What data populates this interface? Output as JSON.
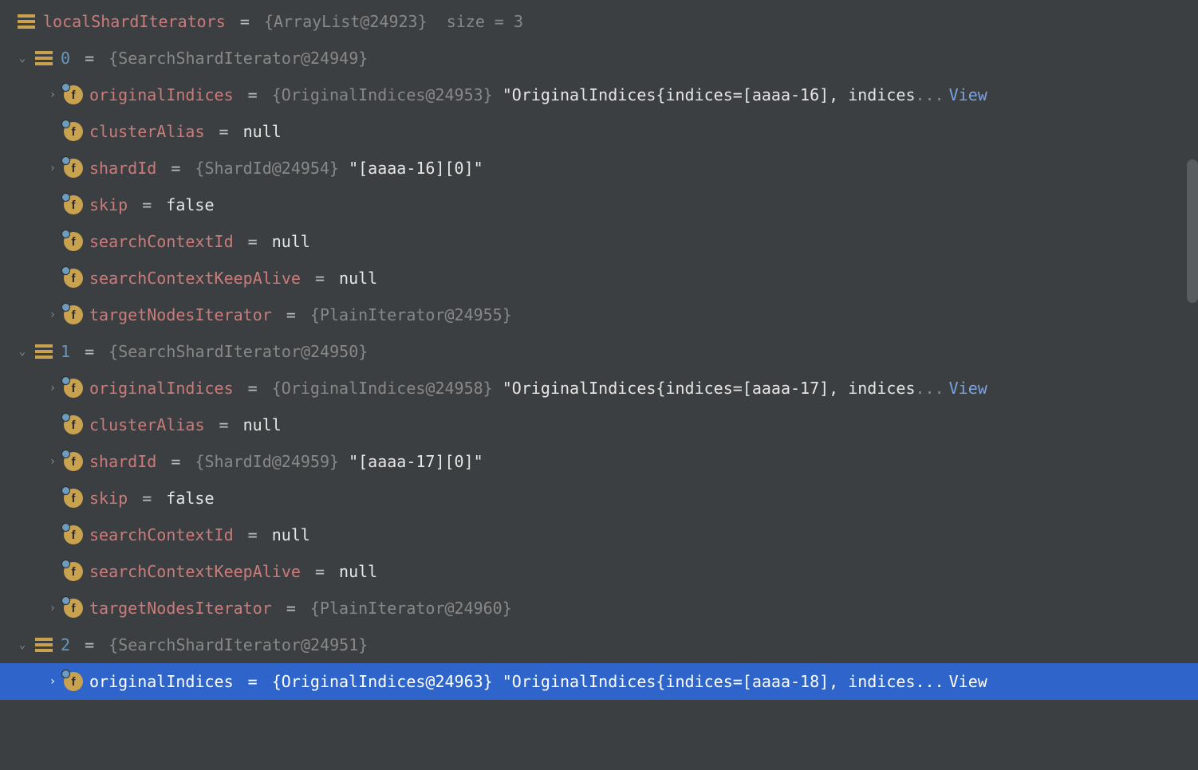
{
  "root": {
    "name": "localShardIterators",
    "type": "{ArrayList@24923}",
    "sizeLabel": "size = 3"
  },
  "items": [
    {
      "idx": "0",
      "type": "{SearchShardIterator@24949}",
      "fields": [
        {
          "name": "originalIndices",
          "type": "{OriginalIndices@24953}",
          "str": "\"OriginalIndices{indices=[aaaa-16], indices",
          "truncated": true,
          "expandable": true
        },
        {
          "name": "clusterAlias",
          "val": "null",
          "expandable": false
        },
        {
          "name": "shardId",
          "type": "{ShardId@24954}",
          "str": "\"[aaaa-16][0]\"",
          "expandable": true
        },
        {
          "name": "skip",
          "val": "false",
          "expandable": false
        },
        {
          "name": "searchContextId",
          "val": "null",
          "expandable": false
        },
        {
          "name": "searchContextKeepAlive",
          "val": "null",
          "expandable": false
        },
        {
          "name": "targetNodesIterator",
          "type": "{PlainIterator@24955}",
          "dim": true,
          "expandable": true
        }
      ]
    },
    {
      "idx": "1",
      "type": "{SearchShardIterator@24950}",
      "fields": [
        {
          "name": "originalIndices",
          "type": "{OriginalIndices@24958}",
          "str": "\"OriginalIndices{indices=[aaaa-17], indices",
          "truncated": true,
          "expandable": true
        },
        {
          "name": "clusterAlias",
          "val": "null",
          "expandable": false
        },
        {
          "name": "shardId",
          "type": "{ShardId@24959}",
          "str": "\"[aaaa-17][0]\"",
          "expandable": true
        },
        {
          "name": "skip",
          "val": "false",
          "expandable": false
        },
        {
          "name": "searchContextId",
          "val": "null",
          "expandable": false
        },
        {
          "name": "searchContextKeepAlive",
          "val": "null",
          "expandable": false
        },
        {
          "name": "targetNodesIterator",
          "type": "{PlainIterator@24960}",
          "dim": true,
          "expandable": true
        }
      ]
    },
    {
      "idx": "2",
      "type": "{SearchShardIterator@24951}",
      "fields": [
        {
          "name": "originalIndices",
          "type": "{OriginalIndices@24963}",
          "str": "\"OriginalIndices{indices=[aaaa-18], indices",
          "truncated": true,
          "expandable": true,
          "selected": true
        }
      ]
    }
  ],
  "labels": {
    "ellipsis": "...",
    "view": "View",
    "equals": "="
  }
}
